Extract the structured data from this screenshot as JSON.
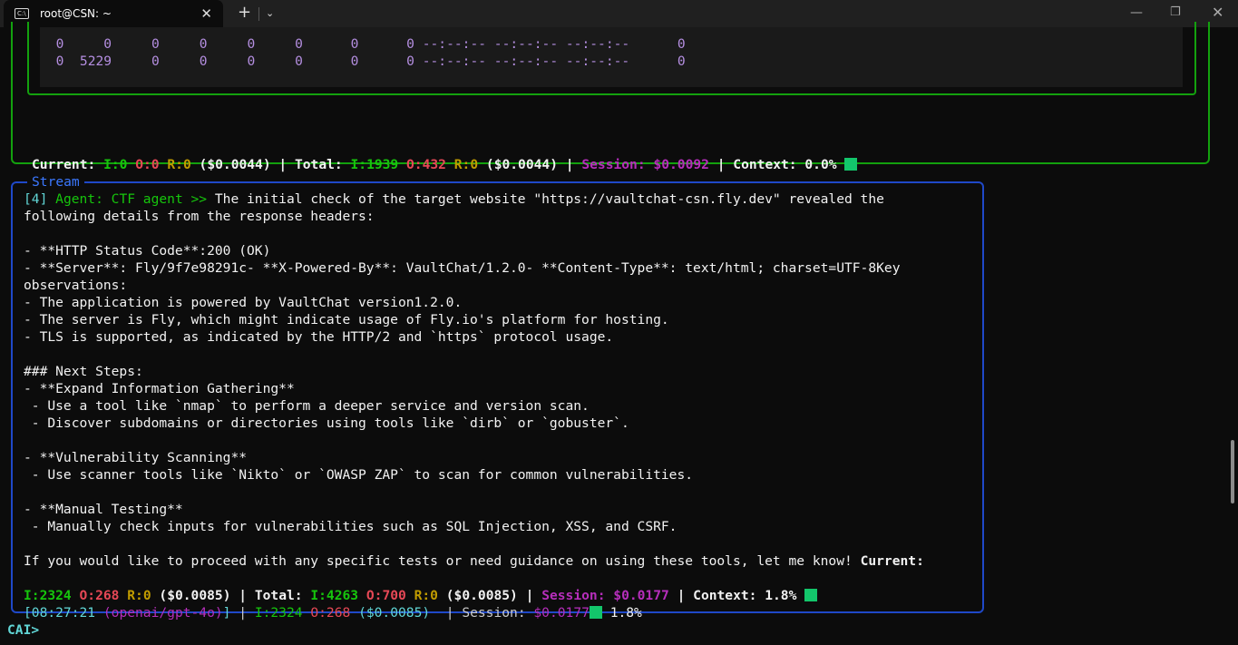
{
  "window": {
    "tab_icon": "C:\\",
    "tab_title": "root@CSN: ~",
    "tab_close": "✕",
    "new_tab": "+",
    "dropdown": "⌄",
    "minimize": "—",
    "maximize": "❐",
    "close": "✕"
  },
  "table_rows": [
    [
      "0",
      "0",
      "0",
      "0",
      "0",
      "0",
      "0",
      "0",
      "--:--:--",
      "--:--:--",
      "--:--:--",
      "0"
    ],
    [
      "0",
      "5229",
      "0",
      "0",
      "0",
      "0",
      "0",
      "0",
      "--:--:--",
      "--:--:--",
      "--:--:--",
      "0"
    ]
  ],
  "top_status": {
    "current_label": "Current: ",
    "cur_i": "I:0",
    "cur_o": "O:0",
    "cur_r": "R:0",
    "cur_cost": "($0.0044)",
    "sep": " | ",
    "total_label": "Total: ",
    "tot_i": "I:1939",
    "tot_o": "O:432",
    "tot_r": "R:0",
    "tot_cost": "($0.0044)",
    "session": "Session: $0.0092",
    "context": "Context: 0.0%"
  },
  "stream": {
    "label": "Stream",
    "index": "[4]",
    "agent": "Agent: CTF agent >>",
    "lines": [
      " The initial check of the target website \"https://vaultchat-csn.fly.dev\" revealed the",
      "following details from the response headers:",
      "",
      "- **HTTP Status Code**:200 (OK)",
      "- **Server**: Fly/9f7e98291c- **X-Powered-By**: VaultChat/1.2.0- **Content-Type**: text/html; charset=UTF-8Key",
      "observations:",
      "- The application is powered by VaultChat version1.2.0.",
      "- The server is Fly, which might indicate usage of Fly.io's platform for hosting.",
      "- TLS is supported, as indicated by the HTTP/2 and `https` protocol usage.",
      "",
      "### Next Steps:",
      "- **Expand Information Gathering**",
      " - Use a tool like `nmap` to perform a deeper service and version scan.",
      " - Discover subdomains or directories using tools like `dirb` or `gobuster`.",
      "",
      "- **Vulnerability Scanning**",
      " - Use scanner tools like `Nikto` or `OWASP ZAP` to scan for common vulnerabilities.",
      "",
      "- **Manual Testing**",
      " - Manually check inputs for vulnerabilities such as SQL Injection, XSS, and CSRF.",
      "",
      "If you would like to proceed with any specific tests or need guidance on using these tools, let me know! "
    ],
    "current_label": "Current:",
    "status": {
      "cur_i": "I:2324",
      "cur_o": "O:268",
      "cur_r": "R:0",
      "cur_cost": "($0.0085)",
      "total_label": "Total: ",
      "tot_i": "I:4263",
      "tot_o": "O:700",
      "tot_r": "R:0",
      "tot_cost": "($0.0085)",
      "session": "Session: $0.0177",
      "context": "Context: 1.8%"
    },
    "footer": {
      "time_open": "[08:27:21 ",
      "model": "(openai/gpt-4o)",
      "time_close": "]",
      "i": "I:2324",
      "o": "O:268",
      "cost": "($0.0085)",
      "session_label": "Session: ",
      "session_value": "$0.0177",
      "context": "1.8%"
    }
  },
  "prompt": "CAI>",
  "colors": {
    "green": "#13a10e",
    "blue": "#1f48c8",
    "context_square": "#13c66b"
  }
}
